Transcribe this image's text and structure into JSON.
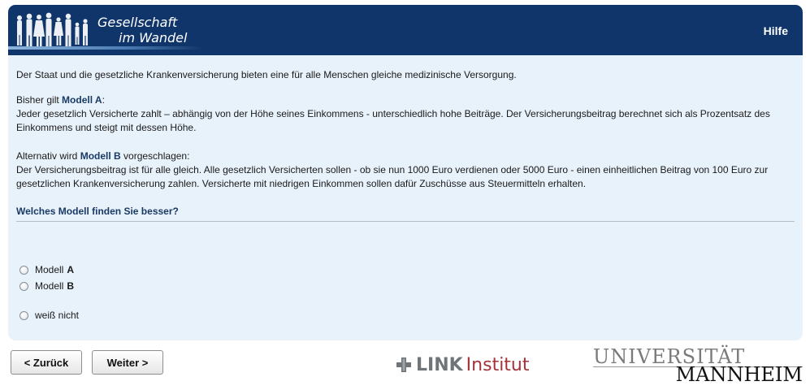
{
  "header": {
    "logo_line1": "Gesellschaft",
    "logo_line2": "im Wandel",
    "help_label": "Hilfe"
  },
  "content": {
    "intro": "Der Staat und die gesetzliche Krankenversicherung bieten eine für alle Menschen gleiche medizinische Versorgung.",
    "model_a_prefix": "Bisher gilt ",
    "model_a_name": "Modell A",
    "model_a_suffix": ":",
    "model_a_text": "Jeder gesetzlich Versicherte zahlt – abhängig von der Höhe seines Einkommens - unterschiedlich hohe Beiträge. Der Versicherungsbeitrag berechnet sich als Prozentsatz des Einkommens und steigt mit dessen Höhe.",
    "model_b_prefix": "Alternativ wird ",
    "model_b_name": "Modell B",
    "model_b_suffix": " vorgeschlagen:",
    "model_b_text": "Der Versicherungsbeitrag ist für alle gleich. Alle gesetzlich Versicherten sollen - ob sie nun 1000 Euro verdienen oder 5000 Euro - einen einheitlichen Beitrag von 100 Euro zur gesetzlichen Krankenversicherung zahlen. Versicherte mit niedrigen Einkommen sollen dafür Zuschüsse aus Steuermitteln erhalten.",
    "question": "Welches Modell finden Sie besser?"
  },
  "options": [
    {
      "label": "Modell",
      "letter": "A",
      "selected": false
    },
    {
      "label": "Modell",
      "letter": "B",
      "selected": false
    },
    {
      "label": "weiß nicht",
      "letter": "",
      "selected": false
    }
  ],
  "nav": {
    "back_label": "< Zurück",
    "next_label": "Weiter >"
  },
  "footer": {
    "link_word": "LINK",
    "institut_word": "Institut",
    "uni_line1": "UNIVERSITÄT",
    "uni_line2": "MANNHEIM"
  },
  "colors": {
    "header_bg": "#10356a",
    "panel_bg": "#e8f2fb",
    "link_red": "#a4343a"
  }
}
